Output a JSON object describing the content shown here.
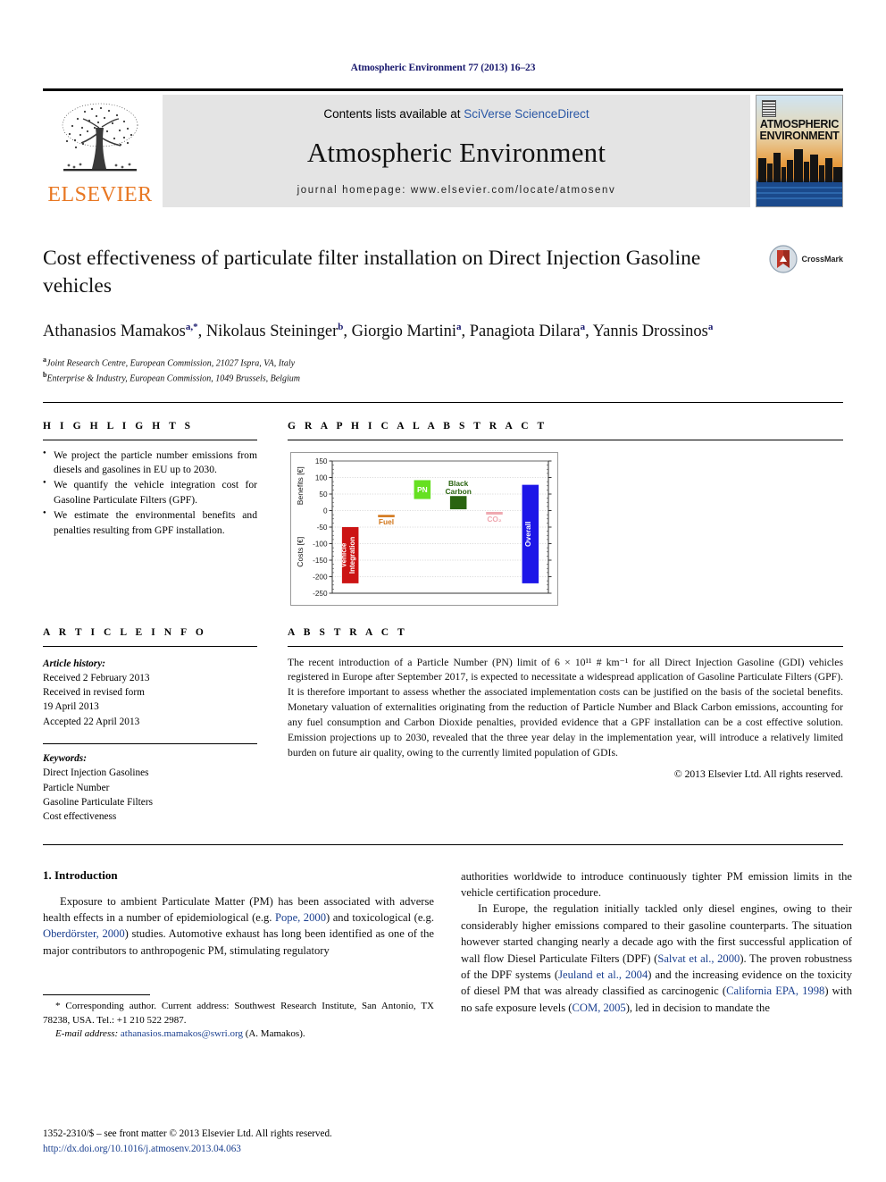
{
  "running_head": "Atmospheric Environment 77 (2013) 16–23",
  "masthead": {
    "contents_prefix": "Contents lists available at ",
    "sciencedirect": "SciVerse ScienceDirect",
    "journal_name": "Atmospheric Environment",
    "homepage": "journal homepage: www.elsevier.com/locate/atmosenv",
    "elsevier_word": "ELSEVIER",
    "cover_title_line1": "ATMOSPHERIC",
    "cover_title_line2": "ENVIRONMENT"
  },
  "title": "Cost effectiveness of particulate filter installation on Direct Injection Gasoline vehicles",
  "crossmark_label": "CrossMark",
  "authors_html": "Athanasios Mamakos<sup>a,&#42;</sup>, Nikolaus Steininger<sup>b</sup>, Giorgio Martini<sup>a</sup>, Panagiota Dilara<sup>a</sup>, Yannis Drossinos<sup>a</sup>",
  "affiliations": [
    {
      "marker": "a",
      "text": "Joint Research Centre, European Commission, 21027 Ispra, VA, Italy"
    },
    {
      "marker": "b",
      "text": "Enterprise & Industry, European Commission, 1049 Brussels, Belgium"
    }
  ],
  "highlights": {
    "heading": "H I G H L I G H T S",
    "items": [
      "We project the particle number emissions from diesels and gasolines in EU up to 2030.",
      "We quantify the vehicle integration cost for Gasoline Particulate Filters (GPF).",
      "We estimate the environmental benefits and penalties resulting from GPF installation."
    ]
  },
  "graphical_abstract": {
    "heading": "G R A P H I C A L   A B S T R A C T"
  },
  "article_info": {
    "heading": "A R T I C L E   I N F O",
    "history_label": "Article history:",
    "history_lines": [
      "Received 2 February 2013",
      "Received in revised form",
      "19 April 2013",
      "Accepted 22 April 2013"
    ],
    "keywords_label": "Keywords:",
    "keywords": [
      "Direct Injection Gasolines",
      "Particle Number",
      "Gasoline Particulate Filters",
      "Cost effectiveness"
    ]
  },
  "abstract": {
    "heading": "A B S T R A C T",
    "text": "The recent introduction of a Particle Number (PN) limit of 6 × 10¹¹ # km⁻¹ for all Direct Injection Gasoline (GDI) vehicles registered in Europe after September 2017, is expected to necessitate a widespread application of Gasoline Particulate Filters (GPF). It is therefore important to assess whether the associated implementation costs can be justified on the basis of the societal benefits. Monetary valuation of externalities originating from the reduction of Particle Number and Black Carbon emissions, accounting for any fuel consumption and Carbon Dioxide penalties, provided evidence that a GPF installation can be a cost effective solution. Emission projections up to 2030, revealed that the three year delay in the implementation year, will introduce a relatively limited burden on future air quality, owing to the currently limited population of GDIs.",
    "copyright": "© 2013 Elsevier Ltd. All rights reserved."
  },
  "chart_data": {
    "type": "bar",
    "title": "",
    "categories": [
      "Vehicle Integration",
      "Fuel",
      "PN",
      "Black Carbon",
      "CO2",
      "Overall"
    ],
    "bar_labels": [
      "Vehicle\nIntegration",
      "Fuel",
      "PN",
      "Black\nCarbon",
      "CO₂",
      "Overall"
    ],
    "bars": [
      {
        "label": "Vehicle Integration",
        "bottom": -220,
        "top": -50,
        "color": "#CC1414",
        "label_inside": true,
        "label_color": "#ffffff"
      },
      {
        "label": "Fuel",
        "bottom": -20,
        "top": -13,
        "color": "#D2761A",
        "label_inside": false,
        "label_color": "#D2761A"
      },
      {
        "label": "PN",
        "bottom": 35,
        "top": 92,
        "color": "#66E021",
        "label_inside": true,
        "label_color": "#ffffff"
      },
      {
        "label": "Black Carbon",
        "bottom": 4,
        "top": 44,
        "color": "#2A6410",
        "label_inside": false,
        "label_color": "#2A6410"
      },
      {
        "label": "CO₂",
        "bottom": -12,
        "top": -4,
        "color": "#EFA8B0",
        "label_inside": false,
        "label_color": "#EFA8B0"
      },
      {
        "label": "Overall",
        "bottom": -220,
        "top": 78,
        "color": "#1D16E8",
        "label_inside": true,
        "label_color": "#ffffff"
      }
    ],
    "ylabel_top": "Benefits [€]",
    "ylabel_bottom": "Costs [€]",
    "xlabel": "",
    "ylim": [
      -250,
      150
    ],
    "yticks": [
      150,
      100,
      50,
      0,
      -50,
      -100,
      -150,
      -200,
      -250
    ],
    "ytick_labels": [
      "150",
      "100",
      "50",
      "0",
      "-50",
      "-100",
      "-150",
      "-200",
      "-250"
    ],
    "grid": true,
    "legend": "none"
  },
  "body": {
    "section_number_title": "1. Introduction",
    "left_paragraphs": [
      "Exposure to ambient Particulate Matter (PM) has been associated with adverse health effects in a number of epidemiological (e.g. @@Pope, 2000@@) and toxicological (e.g. @@Oberdörster, 2000@@) studies. Automotive exhaust has long been identified as one of the major contributors to anthropogenic PM, stimulating regulatory"
    ],
    "right_paragraphs": [
      "authorities worldwide to introduce continuously tighter PM emission limits in the vehicle certification procedure.",
      "In Europe, the regulation initially tackled only diesel engines, owing to their considerably higher emissions compared to their gasoline counterparts. The situation however started changing nearly a decade ago with the first successful application of wall flow Diesel Particulate Filters (DPF) (@@Salvat et al., 2000@@). The proven robustness of the DPF systems (@@Jeuland et al., 2004@@) and the increasing evidence on the toxicity of diesel PM that was already classified as carcinogenic (@@California EPA, 1998@@) with no safe exposure levels (@@COM, 2005@@), led in decision to mandate the"
    ]
  },
  "footnote": {
    "corresponding": "* Corresponding author. Current address: Southwest Research Institute, San Antonio, TX 78238, USA. Tel.: +1 210 522 2987.",
    "email_label": "E-mail address:",
    "email": "athanasios.mamakos@swri.org",
    "email_suffix": "(A. Mamakos)."
  },
  "issn": {
    "line1": "1352-2310/$ – see front matter © 2013 Elsevier Ltd. All rights reserved.",
    "doi": "http://dx.doi.org/10.1016/j.atmosenv.2013.04.063"
  }
}
